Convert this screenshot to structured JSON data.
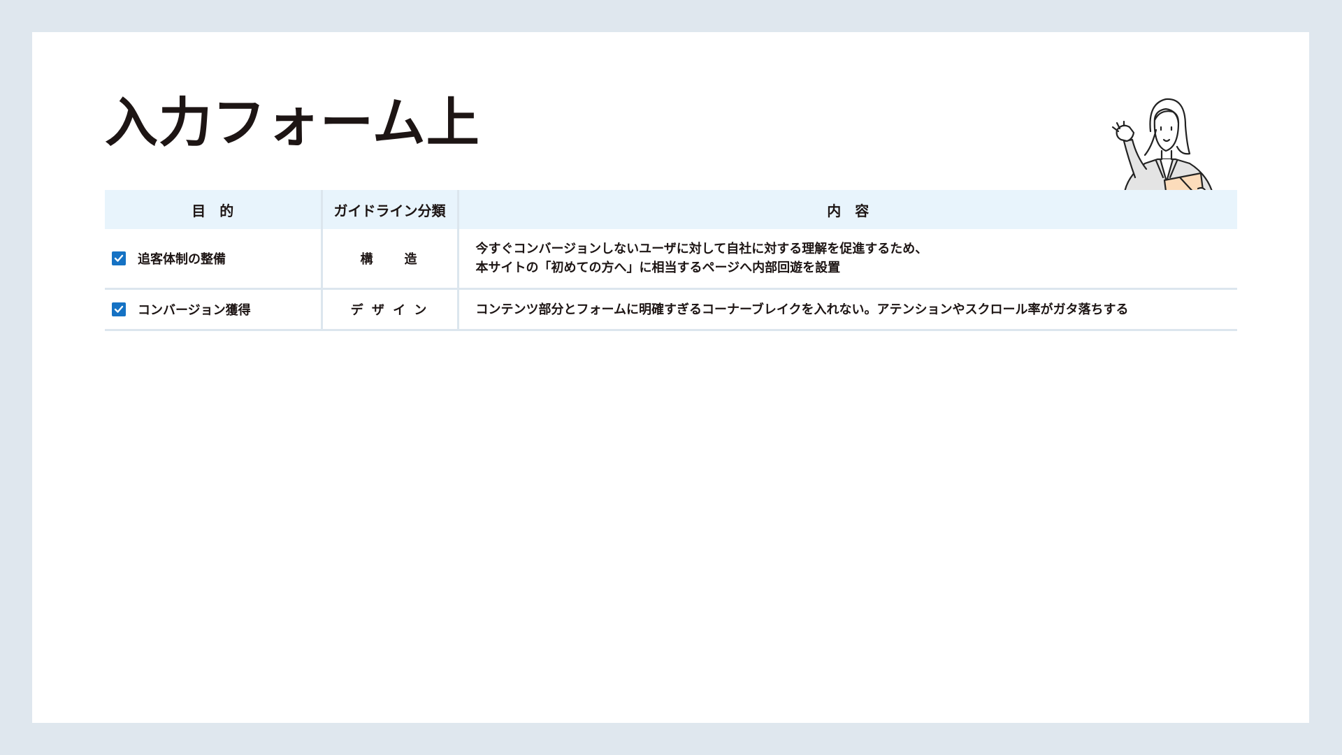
{
  "page": {
    "title": "入力フォーム上"
  },
  "table": {
    "headers": {
      "purpose": "目　的",
      "category": "ガイドライン分類",
      "content": "内　容"
    },
    "rows": [
      {
        "checked": true,
        "purpose": "追客体制の整備",
        "category": "構　　造",
        "content_lines": [
          "今すぐコンバージョンしないユーザに対して自社に対する理解を促進するため、",
          "本サイトの「初めての方へ」に相当するページへ内部回遊を設置"
        ]
      },
      {
        "checked": true,
        "purpose": "コンバージョン獲得",
        "category": "デ ザ イ ン",
        "content_lines": [
          "コンテンツ部分とフォームに明確すぎるコーナーブレイクを入れない。アテンションやスクロール率がガタ落ちする"
        ]
      }
    ]
  },
  "colors": {
    "background": "#dfe7ee",
    "header_fill": "#e8f4fc",
    "checkbox": "#1572c4",
    "text": "#1d1514",
    "rule": "#dce6ee"
  },
  "icons": {
    "checkbox": "checkbox-checked-icon",
    "illustration": "presenter-woman-illustration"
  }
}
